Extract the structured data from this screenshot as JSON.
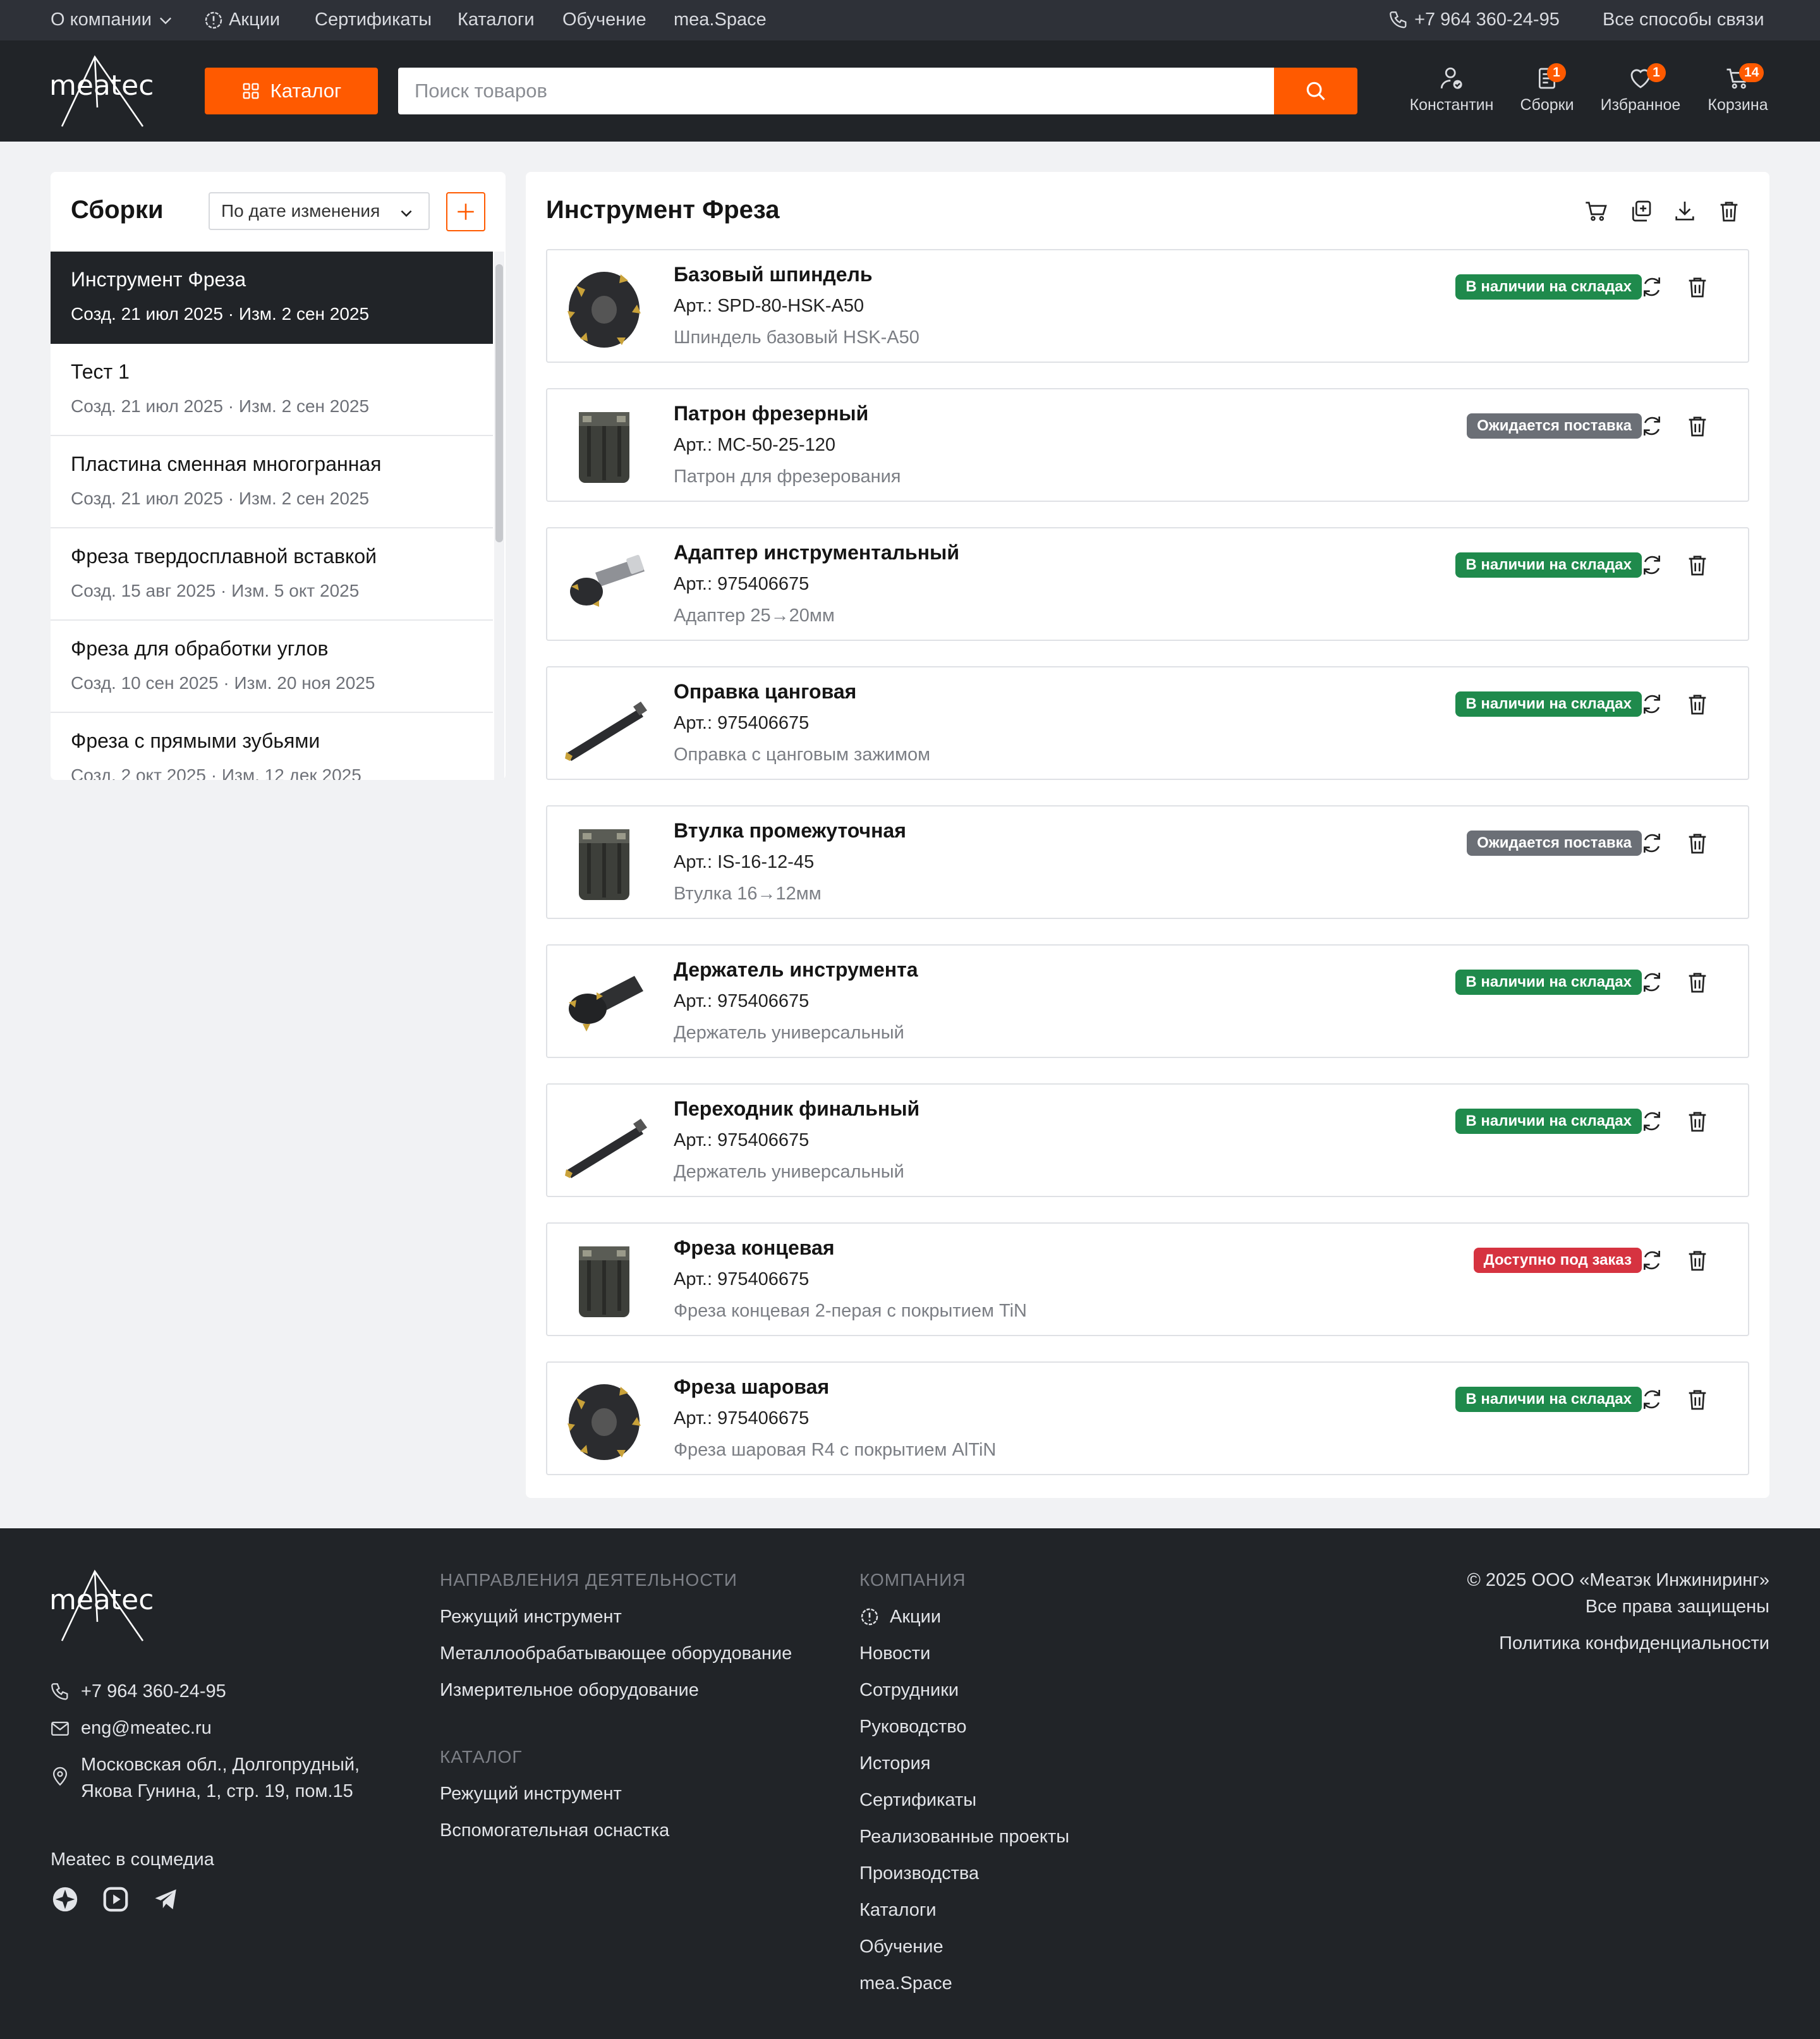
{
  "topbar": {
    "about": "О компании",
    "promo": "Акции",
    "certificates": "Сертификаты",
    "catalogs": "Каталоги",
    "training": "Обучение",
    "space": "mea.Space",
    "phone": "+7 964 360-24-95",
    "contacts": "Все способы связи"
  },
  "header": {
    "logo": "meatec",
    "catalog_button": "Каталог",
    "search_placeholder": "Поиск товаров",
    "user": "Константин",
    "builds": "Сборки",
    "builds_count": "1",
    "favorites": "Избранное",
    "favorites_count": "1",
    "cart": "Корзина",
    "cart_count": "14"
  },
  "sidebar": {
    "title": "Сборки",
    "sort": "По дате изменения",
    "items": [
      {
        "title": "Инструмент Фреза",
        "meta": "Созд. 21 июл 2025 · Изм. 2 сен 2025"
      },
      {
        "title": "Тест 1",
        "meta": "Созд. 21 июл 2025 · Изм. 2 сен 2025"
      },
      {
        "title": "Пластина сменная многогранная",
        "meta": "Созд. 21 июл 2025 · Изм. 2 сен 2025"
      },
      {
        "title": "Фреза твердосплавной вставкой",
        "meta": "Созд. 15 авг 2025 · Изм. 5 окт 2025"
      },
      {
        "title": "Фреза для обработки углов",
        "meta": "Созд. 10 сен 2025 · Изм. 20 ноя 2025"
      },
      {
        "title": "Фреза с прямыми зубьями",
        "meta": "Созд. 2 окт 2025 · Изм. 12 дек 2025"
      }
    ]
  },
  "main": {
    "title": "Инструмент Фреза",
    "products": [
      {
        "name": "Базовый шпиндель",
        "article": "Арт.: SPD-80-HSK-A50",
        "desc": "Шпиндель базовый HSK-A50",
        "status": "В наличии на складах",
        "status_color": "#1f8a4c",
        "icon": "face-mill-icon"
      },
      {
        "name": "Патрон фрезерный",
        "article": "Арт.: MC-50-25-120",
        "desc": "Патрон для фрезерования",
        "status": "Ожидается поставка",
        "status_color": "#6b6f76",
        "icon": "cylinder-mill-icon"
      },
      {
        "name": "Адаптер инструментальный",
        "article": "Арт.: 975406675",
        "desc": "Адаптер 25→20мм",
        "status": "В наличии на складах",
        "status_color": "#1f8a4c",
        "icon": "adapter-icon"
      },
      {
        "name": "Оправка цанговая",
        "article": "Арт.: 975406675",
        "desc": "Оправка с цанговым зажимом",
        "status": "В наличии на складах",
        "status_color": "#1f8a4c",
        "icon": "bar-icon"
      },
      {
        "name": "Втулка промежуточная",
        "article": "Арт.: IS-16-12-45",
        "desc": "Втулка 16→12мм",
        "status": "Ожидается поставка",
        "status_color": "#6b6f76",
        "icon": "cylinder-mill-icon"
      },
      {
        "name": "Держатель инструмента",
        "article": "Арт.: 975406675",
        "desc": "Держатель универсальный",
        "status": "В наличии на складах",
        "status_color": "#1f8a4c",
        "icon": "holder-icon"
      },
      {
        "name": "Переходник финальный",
        "article": "Арт.: 975406675",
        "desc": "Держатель универсальный",
        "status": "В наличии на складах",
        "status_color": "#1f8a4c",
        "icon": "bar-icon"
      },
      {
        "name": "Фреза концевая",
        "article": "Арт.: 975406675",
        "desc": "Фреза концевая 2-перая с покрытием TiN",
        "status": "Доступно под заказ",
        "status_color": "#d63340",
        "icon": "cylinder-mill-icon"
      },
      {
        "name": "Фреза шаровая",
        "article": "Арт.: 975406675",
        "desc": "Фреза шаровая R4 с покрытием AlTiN",
        "status": "В наличии на складах",
        "status_color": "#1f8a4c",
        "icon": "face-mill-icon"
      }
    ]
  },
  "footer": {
    "logo": "meatec",
    "phone": "+7 964 360-24-95",
    "email": "eng@meatec.ru",
    "address_1": "Московская обл., Долгопрудный,",
    "address_2": "Якова Гунина, 1, стр. 19, пом.15",
    "social_title": "Meatec в соцмедиа",
    "col1_title": "НАПРАВЛЕНИЯ ДЕЯТЕЛЬНОСТИ",
    "col1_links": [
      "Режущий инструмент",
      "Металлообрабатывающее оборудование",
      "Измерительное оборудование"
    ],
    "col1b_title": "КАТАЛОГ",
    "col1b_links": [
      "Режущий инструмент",
      "Вспомогательная оснастка"
    ],
    "col2_title": "КОМПАНИЯ",
    "col2_links": [
      "Акции",
      "Новости",
      "Сотрудники",
      "Руководство",
      "История",
      "Сертификаты",
      "Реализованные проекты",
      "Производства",
      "Каталоги",
      "Обучение",
      "mea.Space"
    ],
    "copyright": "© 2025 ООО «Меатэк Инжиниринг»",
    "rights": "Все права защищены",
    "privacy": "Политика конфиденциальности"
  }
}
